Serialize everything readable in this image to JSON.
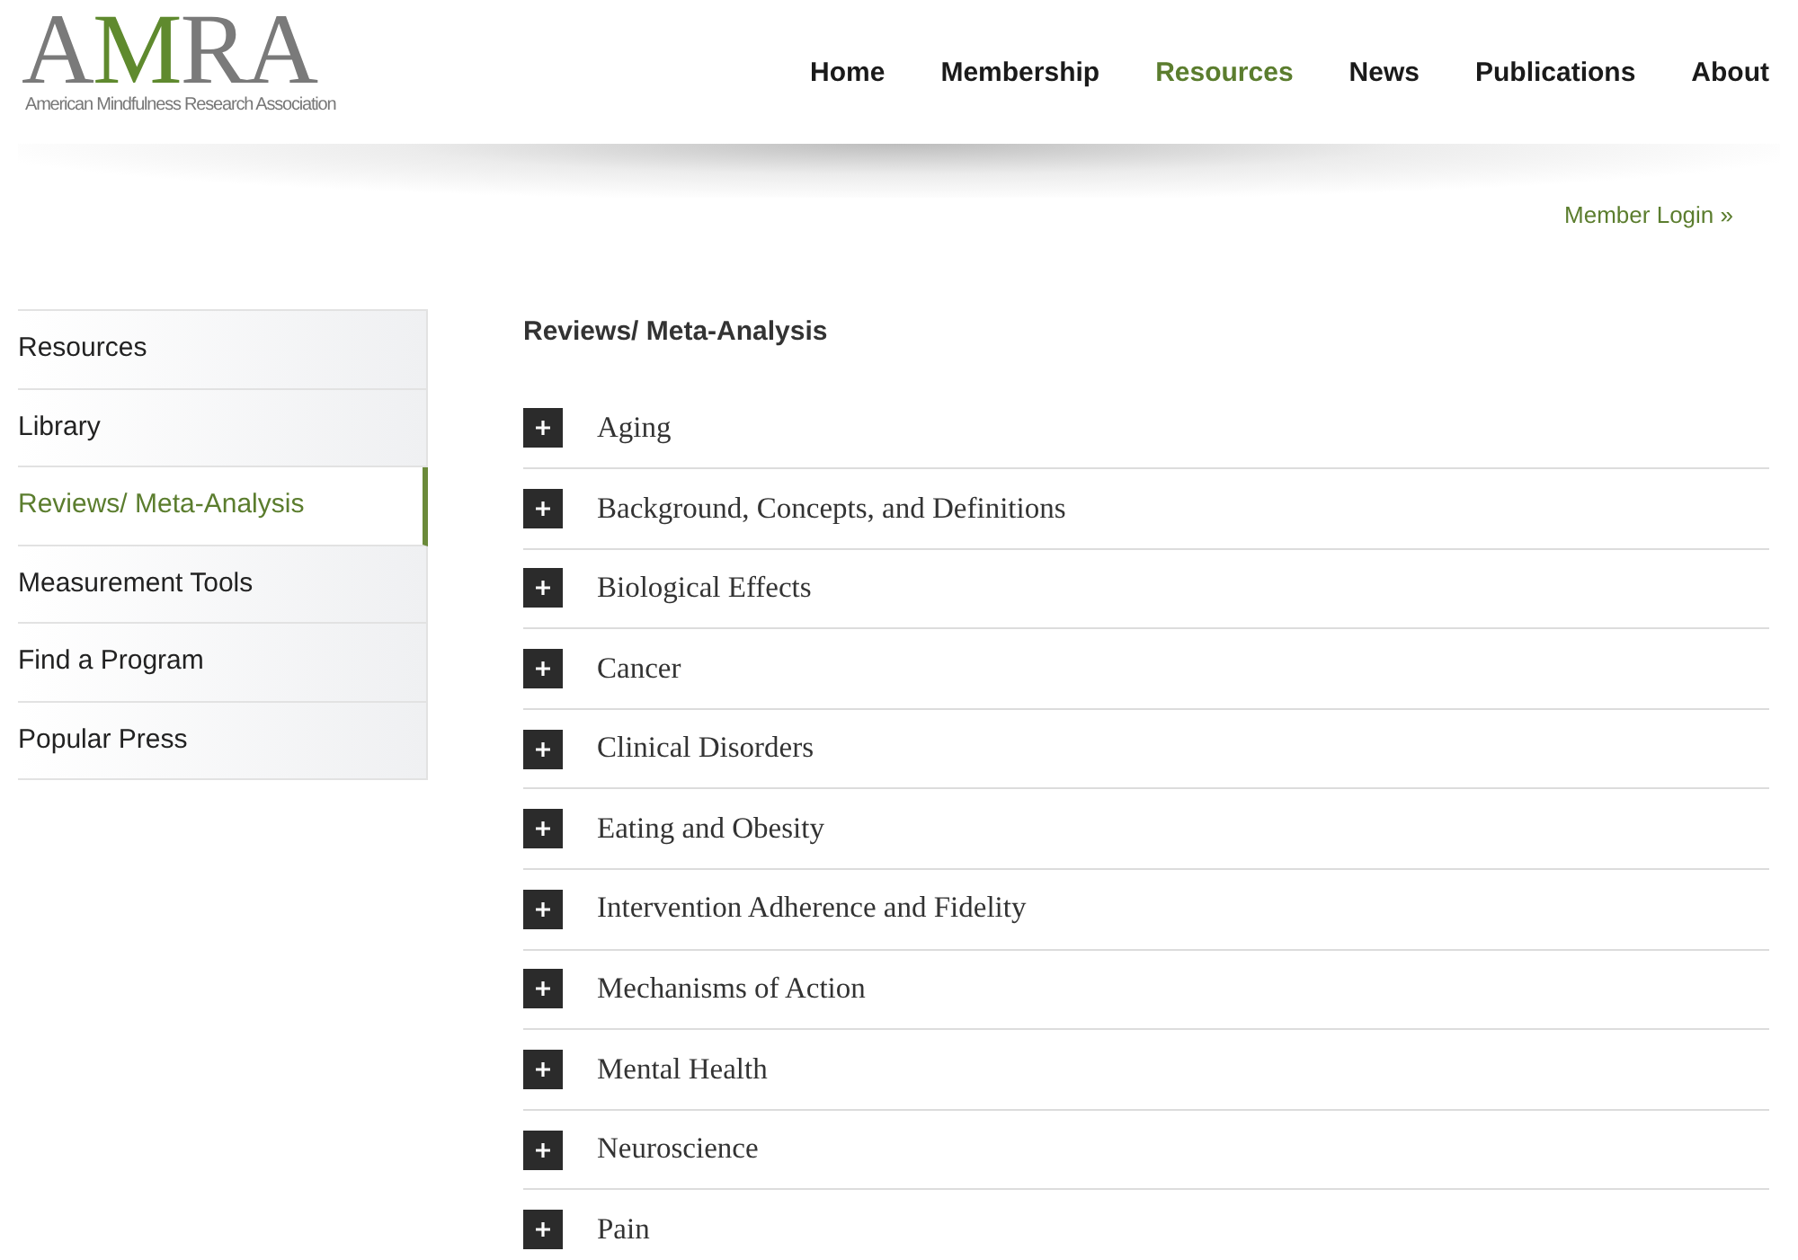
{
  "logo": {
    "letters": [
      {
        "text": "A",
        "accent": false
      },
      {
        "text": "M",
        "accent": true
      },
      {
        "text": "RA",
        "accent": false
      }
    ],
    "tagline": "American Mindfulness Research Association"
  },
  "nav": [
    {
      "label": "Home",
      "selected": false
    },
    {
      "label": "Membership",
      "selected": false
    },
    {
      "label": "Resources",
      "selected": true
    },
    {
      "label": "News",
      "selected": false
    },
    {
      "label": "Publications",
      "selected": false
    },
    {
      "label": "About",
      "selected": false
    }
  ],
  "member_login": "Member Login »",
  "sidebar": {
    "items": [
      {
        "label": "Resources",
        "selected": false
      },
      {
        "label": "Library",
        "selected": false
      },
      {
        "label": "Reviews/ Meta-Analysis",
        "selected": true
      },
      {
        "label": "Measurement Tools",
        "selected": false
      },
      {
        "label": "Find a Program",
        "selected": false
      },
      {
        "label": "Popular Press",
        "selected": false
      }
    ]
  },
  "content": {
    "heading": "Reviews/ Meta-Analysis",
    "accordion": [
      {
        "label": "Aging",
        "expanded": false
      },
      {
        "label": "Background, Concepts, and Definitions",
        "expanded": false
      },
      {
        "label": "Biological Effects",
        "expanded": false
      },
      {
        "label": "Cancer",
        "expanded": false
      },
      {
        "label": "Clinical Disorders",
        "expanded": false
      },
      {
        "label": "Eating and Obesity",
        "expanded": false
      },
      {
        "label": "Intervention Adherence and Fidelity",
        "expanded": false
      },
      {
        "label": "Mechanisms of Action",
        "expanded": false
      },
      {
        "label": "Mental Health",
        "expanded": false
      },
      {
        "label": "Neuroscience",
        "expanded": false
      },
      {
        "label": "Pain",
        "expanded": false
      }
    ]
  }
}
